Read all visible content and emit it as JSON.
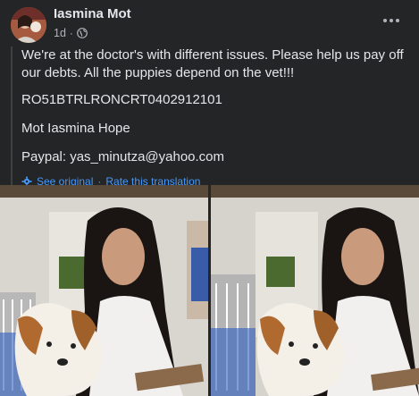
{
  "post": {
    "author": "Iasmina Mot",
    "time": "1d",
    "time_separator": "·",
    "audience_icon": "globe-icon",
    "more_icon": "ellipsis-icon",
    "paragraphs": [
      "We're at the doctor's with different issues. Please help us pay off our debts. All the puppies depend on the vet!!!",
      "RO51BTRLRONCRT0402912101",
      "Mot Iasmina Hope",
      "Paypal: yas_minutza@yahoo.com"
    ],
    "see_original": "See original",
    "translation_separator": "·",
    "rate_translation": "Rate this translation",
    "translation_icon": "gear-icon"
  },
  "photos": [
    {
      "description_icon": "photo-woman-with-puppy"
    },
    {
      "description_icon": "photo-woman-with-puppy"
    }
  ],
  "colors": {
    "background": "#242526",
    "text": "#e4e6eb",
    "secondary_text": "#b0b3b8",
    "link": "#4599ff"
  }
}
